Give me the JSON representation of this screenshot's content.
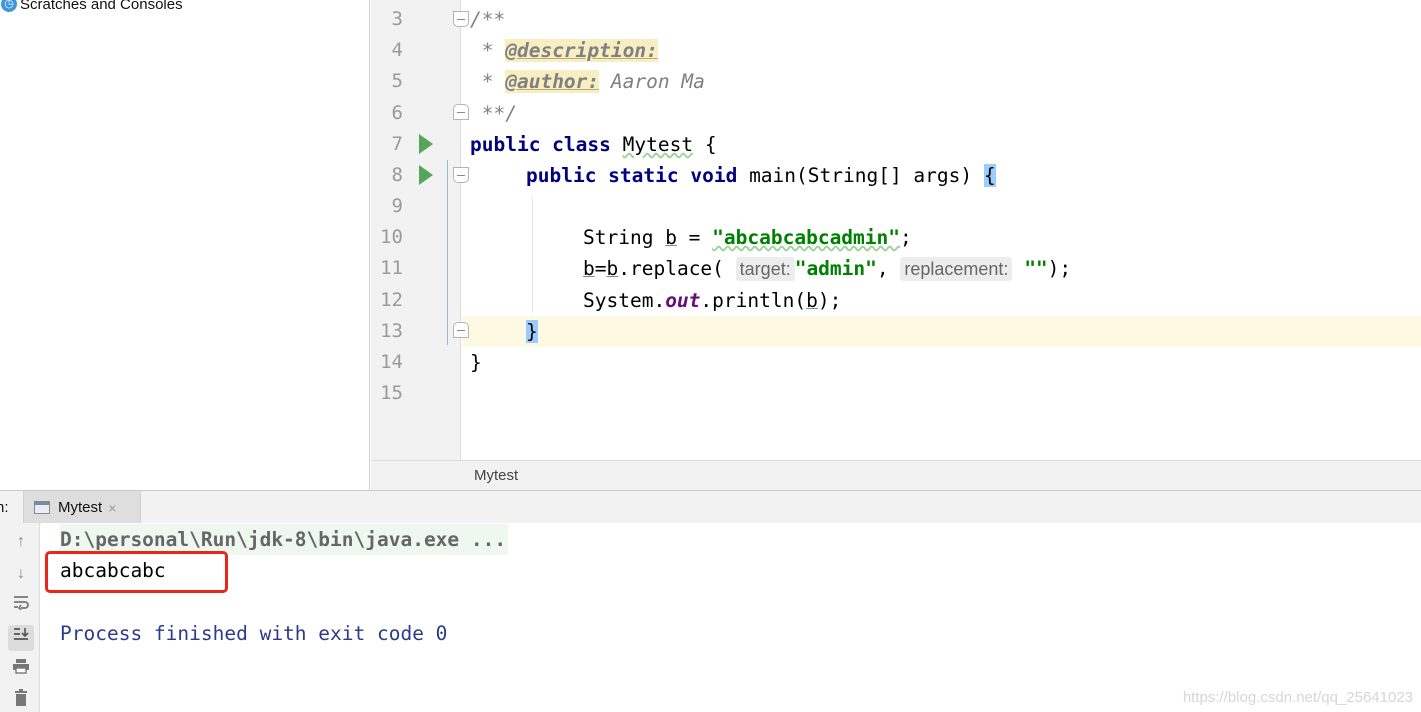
{
  "project": {
    "item_label": "Scratches and Consoles"
  },
  "editor": {
    "line_numbers": [
      "3",
      "4",
      "5",
      "6",
      "7",
      "8",
      "9",
      "10",
      "11",
      "12",
      "13",
      "14",
      "15"
    ],
    "code": {
      "l3": "/**",
      "l4_star": " * ",
      "l4_tag": "@description:",
      "l5_star": " * ",
      "l5_tag": "@author:",
      "l5_author": " Aaron Ma",
      "l6": " **/",
      "l7_kw": "public class ",
      "l7_class": "Mytest",
      "l7_brace": " {",
      "l8_kw": "public static void ",
      "l8_sig": "main(String[] args) ",
      "l8_brace": "{",
      "l10_type": "String ",
      "l10_var": "b",
      "l10_eq": " = ",
      "l10_str": "\"abcabcabcadmin\"",
      "l10_end": ";",
      "l11_var1": "b",
      "l11_eq": "=",
      "l11_var2": "b",
      "l11_call": ".replace(",
      "l11_hint1": "target:",
      "l11_arg1": "\"admin\"",
      "l11_comma": ", ",
      "l11_hint2": "replacement:",
      "l11_arg2": "\"\"",
      "l11_end": ");",
      "l12_sys": "System.",
      "l12_out": "out",
      "l12_call": ".println(",
      "l12_var": "b",
      "l12_end": ");",
      "l13": "}",
      "l14": "}"
    },
    "breadcrumb": "Mytest"
  },
  "run": {
    "label": "n:",
    "tab_label": "Mytest",
    "tab_close": "×",
    "command": "D:\\personal\\Run\\jdk-8\\bin\\java.exe ...",
    "output": "abcabcabc",
    "exit_message": "Process finished with exit code 0"
  },
  "watermark": "https://blog.csdn.net/qq_25641023",
  "colors": {
    "keyword": "#000080",
    "string": "#008000",
    "comment": "#808080",
    "run_arrow": "#55a65a",
    "highlight_box": "#e8261c"
  }
}
